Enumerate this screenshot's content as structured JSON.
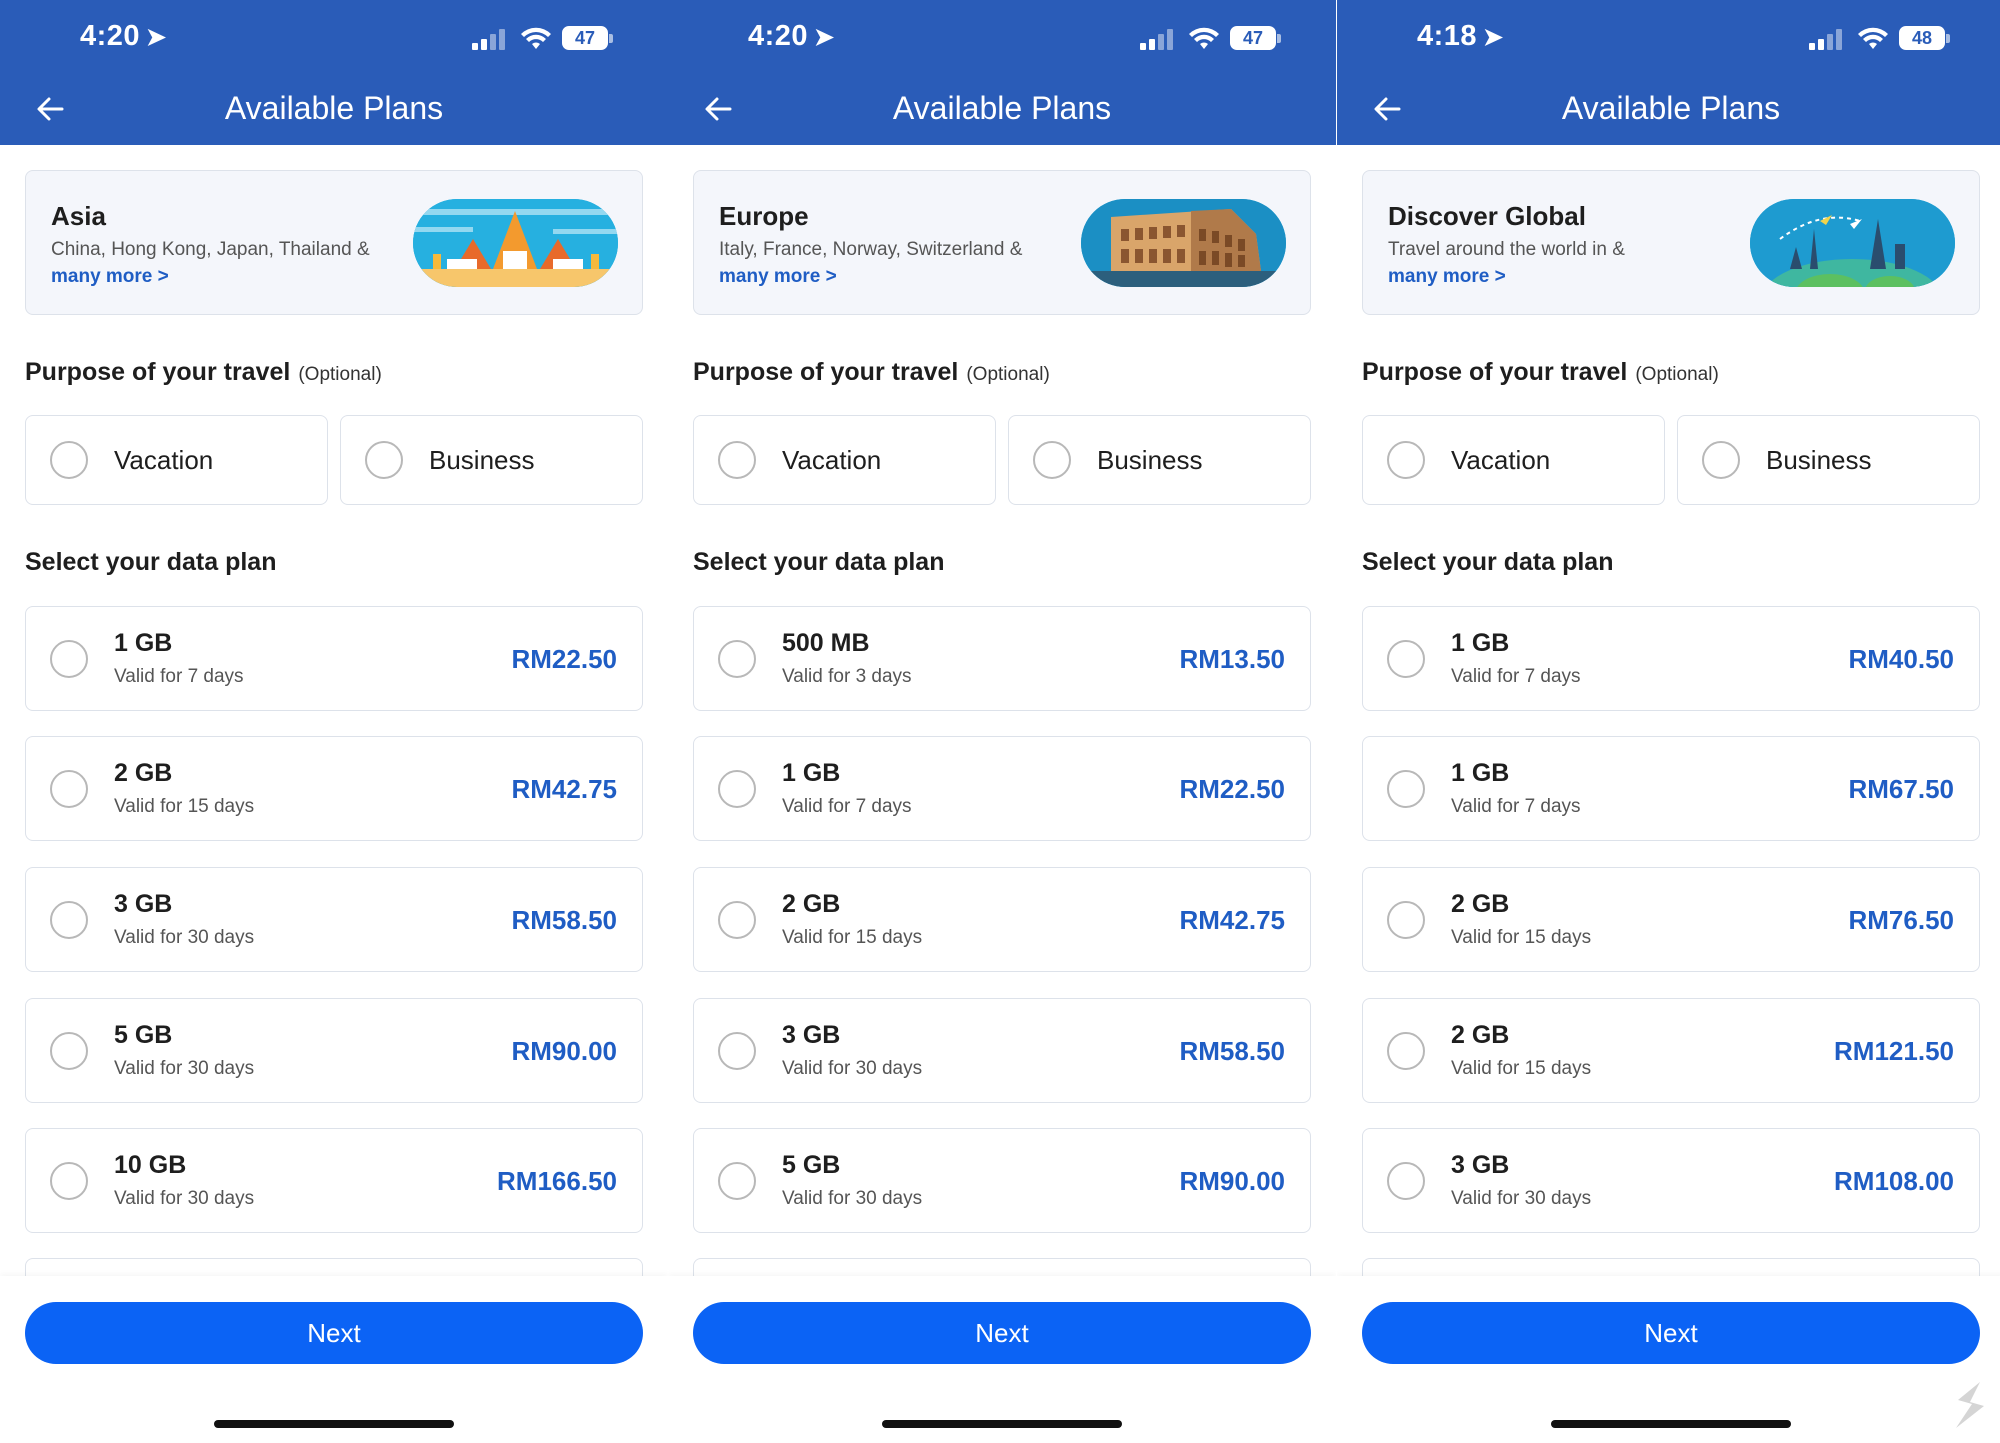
{
  "screens": [
    {
      "status": {
        "time": "4:20",
        "battery": "47",
        "signal_bars": 2
      },
      "header": {
        "title": "Available Plans"
      },
      "destination": {
        "name": "Asia",
        "description": "China, Hong Kong, Japan, Thailand &",
        "more_link": "many more >",
        "image_icon": "temple-illustration"
      },
      "purpose": {
        "title": "Purpose of your travel",
        "optional": "(Optional)",
        "options": [
          "Vacation",
          "Business"
        ]
      },
      "plans_title": "Select your data plan",
      "plans": [
        {
          "size": "1 GB",
          "validity": "Valid for 7 days",
          "price": "RM22.50"
        },
        {
          "size": "2 GB",
          "validity": "Valid for 15 days",
          "price": "RM42.75"
        },
        {
          "size": "3 GB",
          "validity": "Valid for 30 days",
          "price": "RM58.50"
        },
        {
          "size": "5 GB",
          "validity": "Valid for 30 days",
          "price": "RM90.00"
        },
        {
          "size": "10 GB",
          "validity": "Valid for 30 days",
          "price": "RM166.50"
        }
      ],
      "next_label": "Next"
    },
    {
      "status": {
        "time": "4:20",
        "battery": "47",
        "signal_bars": 2
      },
      "header": {
        "title": "Available Plans"
      },
      "destination": {
        "name": "Europe",
        "description": "Italy, France, Norway, Switzerland &",
        "more_link": "many more >",
        "image_icon": "colosseum-illustration"
      },
      "purpose": {
        "title": "Purpose of your travel",
        "optional": "(Optional)",
        "options": [
          "Vacation",
          "Business"
        ]
      },
      "plans_title": "Select your data plan",
      "plans": [
        {
          "size": "500 MB",
          "validity": "Valid for 3 days",
          "price": "RM13.50"
        },
        {
          "size": "1 GB",
          "validity": "Valid for 7 days",
          "price": "RM22.50"
        },
        {
          "size": "2 GB",
          "validity": "Valid for 15 days",
          "price": "RM42.75"
        },
        {
          "size": "3 GB",
          "validity": "Valid for 30 days",
          "price": "RM58.50"
        },
        {
          "size": "5 GB",
          "validity": "Valid for 30 days",
          "price": "RM90.00"
        }
      ],
      "next_label": "Next"
    },
    {
      "status": {
        "time": "4:18",
        "battery": "48",
        "signal_bars": 2
      },
      "header": {
        "title": "Available Plans"
      },
      "destination": {
        "name": "Discover Global",
        "description": "Travel around the world in &",
        "more_link": "many more >",
        "image_icon": "globe-illustration"
      },
      "purpose": {
        "title": "Purpose of your travel",
        "optional": "(Optional)",
        "options": [
          "Vacation",
          "Business"
        ]
      },
      "plans_title": "Select your data plan",
      "plans": [
        {
          "size": "1 GB",
          "validity": "Valid for 7 days",
          "price": "RM40.50"
        },
        {
          "size": "1 GB",
          "validity": "Valid for 7 days",
          "price": "RM67.50"
        },
        {
          "size": "2 GB",
          "validity": "Valid for 15 days",
          "price": "RM76.50"
        },
        {
          "size": "2 GB",
          "validity": "Valid for 15 days",
          "price": "RM121.50"
        },
        {
          "size": "3 GB",
          "validity": "Valid for 30 days",
          "price": "RM108.00"
        }
      ],
      "next_label": "Next"
    }
  ],
  "colors": {
    "header": "#2a5cb8",
    "accent": "#0b63f5",
    "price": "#1f5dc4"
  }
}
